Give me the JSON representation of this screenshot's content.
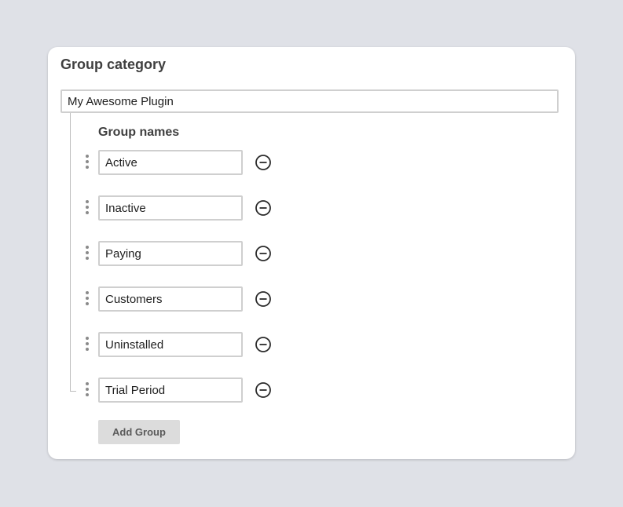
{
  "card": {
    "title": "Group category",
    "category_value": "My Awesome Plugin"
  },
  "groups": {
    "label": "Group names",
    "items": [
      {
        "value": "Active"
      },
      {
        "value": "Inactive"
      },
      {
        "value": "Paying"
      },
      {
        "value": "Customers"
      },
      {
        "value": "Uninstalled"
      },
      {
        "value": "Trial Period"
      }
    ]
  },
  "actions": {
    "add_group_label": "Add Group"
  },
  "icons": {
    "drag": "drag-handle-icon",
    "remove": "remove-circle-icon"
  }
}
